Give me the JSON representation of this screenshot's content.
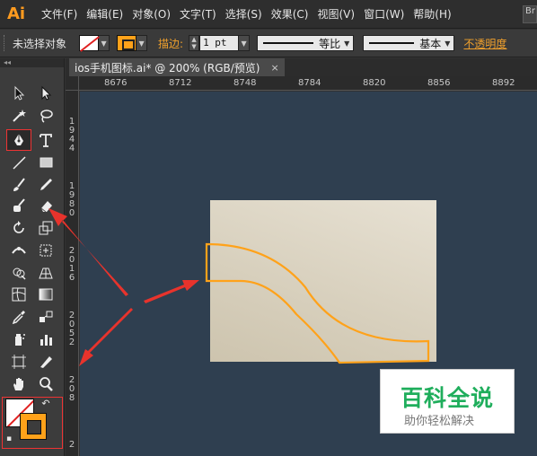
{
  "app": {
    "logo": "Ai"
  },
  "menu": {
    "items": [
      "文件(F)",
      "编辑(E)",
      "对象(O)",
      "文字(T)",
      "选择(S)",
      "效果(C)",
      "视图(V)",
      "窗口(W)",
      "帮助(H)"
    ],
    "bridge_label": "Br"
  },
  "control_bar": {
    "selection_status": "未选择对象",
    "stroke_label": "描边:",
    "stroke_weight": "1 pt",
    "profile_label": "等比",
    "brush_label": "基本",
    "opacity_label": "不透明度"
  },
  "document_tab": {
    "title": "ios手机图标.ai* @ 200% (RGB/预览)",
    "close": "×"
  },
  "ruler": {
    "h_ticks": [
      "8676",
      "8712",
      "8748",
      "8784",
      "8820",
      "8856",
      "8892"
    ],
    "v_ticks": [
      "1944",
      "1980",
      "2016",
      "2052",
      "208",
      "2"
    ]
  },
  "watermark": {
    "title": "百科全说",
    "subtitle": "助你轻松解决"
  },
  "colors": {
    "accent": "#ffa21a",
    "canvas": "#2f3f50",
    "annotation_arrow": "#e8332c",
    "watermark_green": "#1fae5c"
  }
}
